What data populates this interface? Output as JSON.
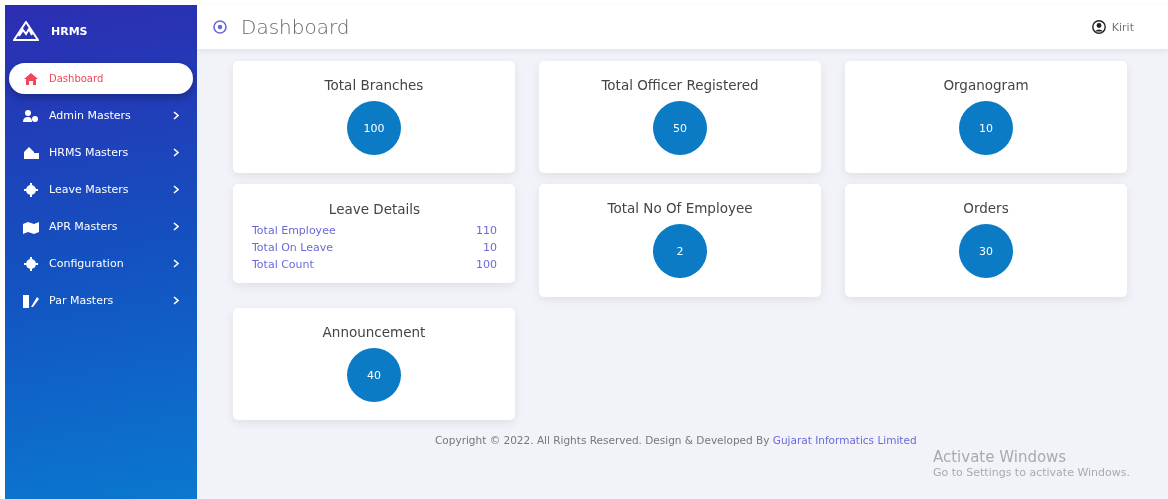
{
  "sidebar": {
    "brand": "HRMS",
    "items": [
      {
        "label": "Dashboard",
        "selected": true,
        "expandable": false
      },
      {
        "label": "Admin Masters",
        "selected": false,
        "expandable": true
      },
      {
        "label": "HRMS Masters",
        "selected": false,
        "expandable": true
      },
      {
        "label": "Leave Masters",
        "selected": false,
        "expandable": true
      },
      {
        "label": "APR Masters",
        "selected": false,
        "expandable": true
      },
      {
        "label": "Configuration",
        "selected": false,
        "expandable": true
      },
      {
        "label": "Par Masters",
        "selected": false,
        "expandable": true
      }
    ]
  },
  "header": {
    "title": "Dashboard",
    "user": "Kirit"
  },
  "cards": [
    {
      "kind": "count",
      "title": "Total Branches",
      "value": "100"
    },
    {
      "kind": "count",
      "title": "Total Officer Registered",
      "value": "50"
    },
    {
      "kind": "count",
      "title": "Organogram",
      "value": "10"
    },
    {
      "kind": "details",
      "title": "Leave Details",
      "rows": [
        {
          "label": "Total Employee",
          "value": "110"
        },
        {
          "label": "Total On Leave",
          "value": "10"
        },
        {
          "label": "Total Count",
          "value": "100"
        }
      ]
    },
    {
      "kind": "count",
      "title": "Total No Of Employee",
      "value": "2"
    },
    {
      "kind": "count",
      "title": "Orders",
      "value": "30"
    },
    {
      "kind": "count",
      "title": "Announcement",
      "value": "40"
    }
  ],
  "footer": {
    "text": "Copyright © 2022. All Rights Reserved. Design & Developed By",
    "link": "Gujarat Informatics Limited"
  },
  "os_notice": {
    "title": "Activate Windows",
    "text": "Go to Settings to activate Windows."
  }
}
